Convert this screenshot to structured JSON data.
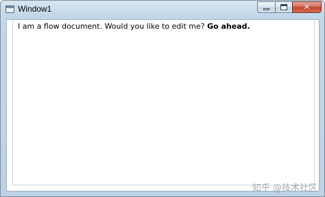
{
  "window": {
    "title": "Window1"
  },
  "caption_buttons": {
    "minimize_icon": "minimize-icon",
    "maximize_icon": "maximize-icon",
    "close_icon": "close-icon",
    "close_glyph": "✕"
  },
  "document": {
    "text_plain": "I am a flow document. Would you like to edit me? ",
    "text_bold": "Go ahead."
  },
  "watermark": {
    "text": "知乎 @技术社区"
  },
  "colors": {
    "frame": "#c3d7ea",
    "close_button": "#c2432f"
  }
}
